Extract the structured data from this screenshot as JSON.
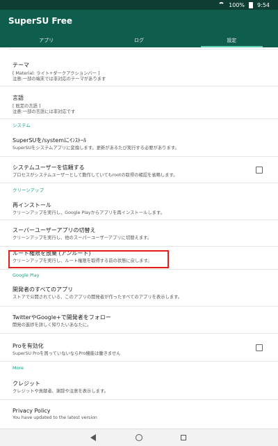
{
  "status_bar": {
    "battery": "100%",
    "time": "9:54"
  },
  "app": {
    "title": "SuperSU Free"
  },
  "tabs": [
    {
      "label": "アプリ"
    },
    {
      "label": "ログ"
    },
    {
      "label": "設定",
      "active": true
    }
  ],
  "settings": {
    "theme": {
      "title": "テーマ",
      "value": "[ Material: ライト+ダークアクションバー ]",
      "note": "注意:一部の端末では非対応のテーマがあります"
    },
    "language": {
      "title": "言語",
      "value": "[ 既定の言語 ]",
      "note": "注意:一部の言語には非対応です"
    },
    "section_system": "システム",
    "install_system": {
      "title": "SuperSUを/systemにｲﾝｽﾄｰﾙ",
      "summary": "SuperSUをシステムアプリに変換します。更新があるたび実行する必要があります。"
    },
    "trust_system_user": {
      "title": "システムユーザーを信頼する",
      "summary": "プロセスがシステムユーザーとして動作していてもrootの取得の確認を省略します。",
      "checked": false
    },
    "section_cleanup": "クリーンアップ",
    "reinstall": {
      "title": "再インストール",
      "summary": "クリーンアップを実行し、Google Playからアプリを再インストールします。"
    },
    "switch_su": {
      "title": "スーパーユーザーアプリの切替え",
      "summary": "クリーンアップを実行し、他のスーパーユーザーアプリに切替えます。"
    },
    "unroot": {
      "title": "ルート権限を放棄 (アンルート)",
      "summary": "クリーンアップを実行し、ルート権限を取得する前の状態に戻します。"
    },
    "section_google_play": "Google Play",
    "developer_apps": {
      "title": "開発者のすべてのアプリ",
      "summary": "ストアで公開されている、このアプリの開発者が作ったすべてのアプリを表示します。"
    },
    "follow": {
      "title": "TwitterやGoogle+で開発者をフォロー",
      "summary": "開発の進捗を詳しく知りたいあなたに。"
    },
    "pro": {
      "title": "Proを有効化",
      "summary": "SuperSU Proを買っていないならPro機能は働きません",
      "checked": false
    },
    "section_more": "More",
    "credits": {
      "title": "クレジット",
      "summary": "クレジットや貢献者、謝辞や注意を表示します。"
    },
    "privacy": {
      "title": "Privacy Policy",
      "summary": "You have updated to the latest version"
    }
  },
  "colors": {
    "appbar": "#0f5d4c",
    "statusbar": "#0d3d33",
    "accent": "#17a083",
    "highlight": "#e31d1d"
  }
}
